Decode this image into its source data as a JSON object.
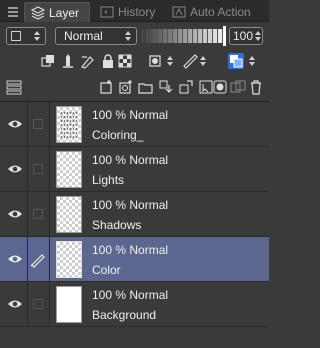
{
  "tabs": [
    {
      "label": "Layer",
      "active": true
    },
    {
      "label": "History",
      "active": false
    },
    {
      "label": "Auto Action",
      "active": false
    }
  ],
  "blend": {
    "mode": "Normal",
    "opacity_value": "100",
    "opacity_fraction": 1.0
  },
  "layers": [
    {
      "info": "100 % Normal",
      "name": "Coloring_",
      "visible": true,
      "selected": false,
      "editing": false,
      "thumb": "sketch"
    },
    {
      "info": "100 % Normal",
      "name": "Lights",
      "visible": true,
      "selected": false,
      "editing": false,
      "thumb": "transparent"
    },
    {
      "info": "100 % Normal",
      "name": "Shadows",
      "visible": true,
      "selected": false,
      "editing": false,
      "thumb": "transparent"
    },
    {
      "info": "100 % Normal",
      "name": "Color",
      "visible": true,
      "selected": true,
      "editing": true,
      "thumb": "transparent"
    },
    {
      "info": "100 % Normal",
      "name": "Background",
      "visible": true,
      "selected": false,
      "editing": false,
      "thumb": "white"
    }
  ],
  "colors": {
    "panel": "#3a3a3a",
    "selected_row": "#5b678f",
    "accent_blue": "#2f6fd6"
  }
}
